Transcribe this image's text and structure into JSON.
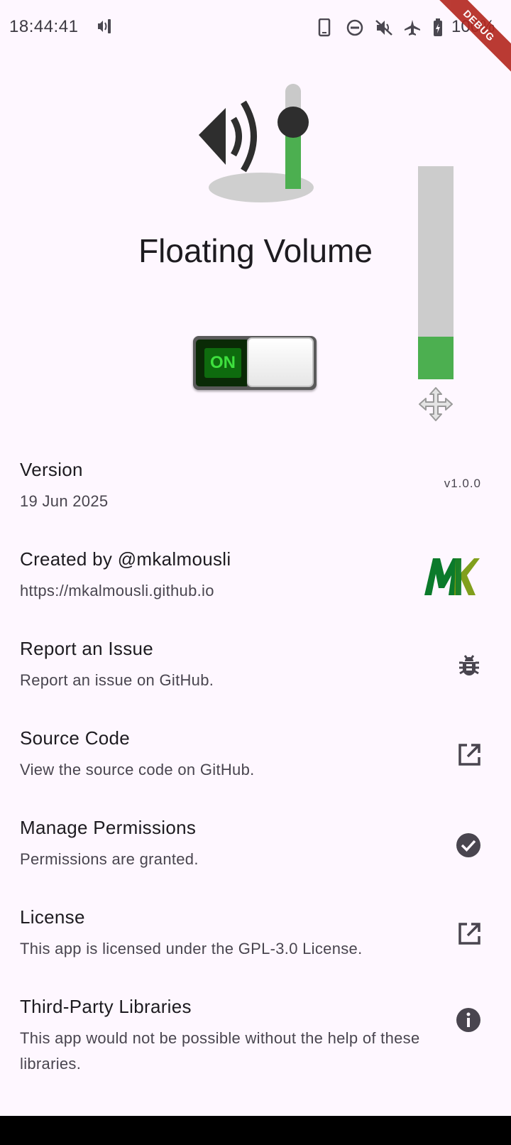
{
  "status_bar": {
    "time": "18:44:41",
    "battery": "100%",
    "icons": [
      "volume-vibrate-icon",
      "phone-icon",
      "do-not-disturb-icon",
      "mute-icon",
      "airplane-icon",
      "battery-icon"
    ],
    "debug_banner": "DEBUG"
  },
  "app": {
    "title": "Floating Volume",
    "logo_icon": "speaker-slider-icon",
    "toggle_label": "ON",
    "toggle_state": "on"
  },
  "volume_overlay": {
    "level_fraction": 0.2,
    "fill_color": "#4caf50",
    "track_color": "#cccccc",
    "handle_icon": "move-arrows-icon"
  },
  "tiles": [
    {
      "title": "Version",
      "subtitle": "19 Jun 2025",
      "trailing_text": "v1.0.0"
    },
    {
      "title": "Created by @mkalmousli",
      "subtitle": "https://mkalmousli.github.io",
      "trailing_icon": "mk-logo-icon"
    },
    {
      "title": "Report an Issue",
      "subtitle": "Report an issue on GitHub.",
      "trailing_icon": "bug-icon"
    },
    {
      "title": "Source Code",
      "subtitle": "View the source code on GitHub.",
      "trailing_icon": "open-external-icon"
    },
    {
      "title": "Manage Permissions",
      "subtitle": "Permissions are granted.",
      "trailing_icon": "check-circle-icon"
    },
    {
      "title": "License",
      "subtitle": "This app is licensed under the GPL-3.0 License.",
      "trailing_icon": "open-external-icon"
    },
    {
      "title": "Third-Party Libraries",
      "subtitle": "This app would not be possible without the help of these libraries.",
      "trailing_icon": "info-icon"
    }
  ],
  "colors": {
    "background": "#fef7ff",
    "accent_green": "#4caf50",
    "toggle_on_text": "#3ee03e",
    "debug_ribbon": "#b3261e"
  }
}
